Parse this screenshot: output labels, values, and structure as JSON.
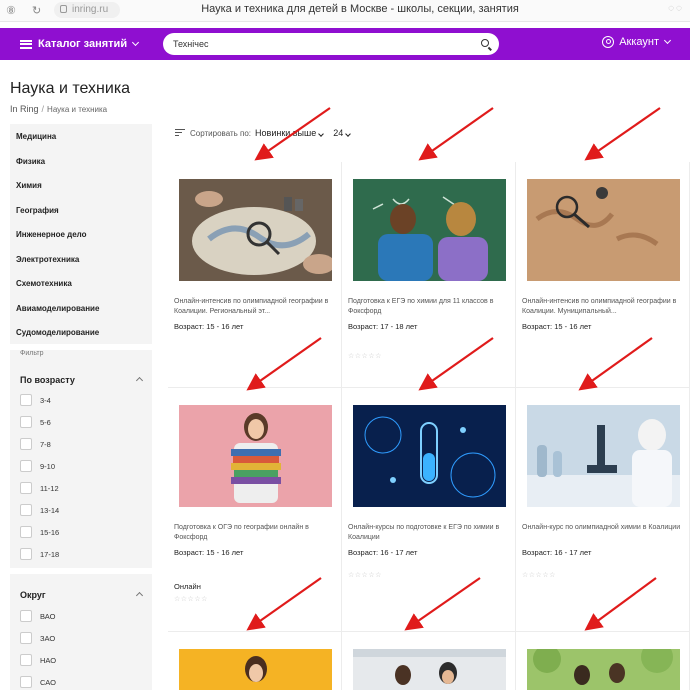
{
  "browser": {
    "url": "inring.ru",
    "tab_title": "Наука и техника для детей в Москве - школы, секции, занятия"
  },
  "header": {
    "catalog_label": "Каталог занятий",
    "search_value": "Технічес",
    "account_label": "Аккаунт",
    "accent_color": "#8f0fd0"
  },
  "page": {
    "title": "Наука и техника",
    "breadcrumb": {
      "home": "In Ring",
      "sep": "/",
      "current": "Наука и техника"
    }
  },
  "sidebar": {
    "categories": [
      "Медицина",
      "Физика",
      "Химия",
      "География",
      "Инженерное дело",
      "Электротехника",
      "Схемотехника",
      "Авиамоделирование",
      "Судомоделирование"
    ],
    "filter_label": "Фильтр",
    "age_filter": {
      "title": "По возрасту",
      "options": [
        "3-4",
        "5-6",
        "7-8",
        "9-10",
        "11-12",
        "13-14",
        "15-16",
        "17-18"
      ]
    },
    "district_filter": {
      "title": "Округ",
      "options": [
        "ВАО",
        "ЗАО",
        "НАО",
        "САО"
      ]
    }
  },
  "sort": {
    "label": "Сортировать по:",
    "value": "Новинки выше",
    "per_page": "24"
  },
  "cards": [
    {
      "title": "Онлайн-интенсив по олимпиадной географии в Коалиции. Региональный эт...",
      "age": "Возраст: 15 - 16 лет",
      "image": "map-magnifier-photo"
    },
    {
      "title": "Подготовка к ЕГЭ по химии для 11 классов в Фоксфорд",
      "age": "Возраст: 17 - 18 лет",
      "image": "students-at-blackboard-photo"
    },
    {
      "title": "Онлайн-интенсив по олимпиадной географии в Коалиции. Муниципальный...",
      "age": "Возраст: 15 - 16 лет",
      "image": "vintage-map-magnifier-photo"
    },
    {
      "title": "Подготовка к ОГЭ по географии онлайн в Фоксфорд",
      "age": "Возраст: 15 - 16 лет",
      "online": "Онлайн",
      "image": "girl-with-books-photo"
    },
    {
      "title": "Онлайн-курсы по подготовке к ЕГЭ по химии в Коалиции",
      "age": "Возраст: 16 - 17 лет",
      "image": "test-tube-digital-photo"
    },
    {
      "title": "Онлайн-курс по олимпиадной химии в Коалиции",
      "age": "Возраст: 16 - 17 лет",
      "image": "microscope-lab-photo"
    },
    {
      "title": "",
      "age": "",
      "image": "girl-yellow-background-photo"
    },
    {
      "title": "",
      "age": "",
      "image": "students-classroom-photo"
    },
    {
      "title": "",
      "age": "",
      "image": "kids-outdoors-photo"
    }
  ],
  "annotation_color": "#e01b1b"
}
